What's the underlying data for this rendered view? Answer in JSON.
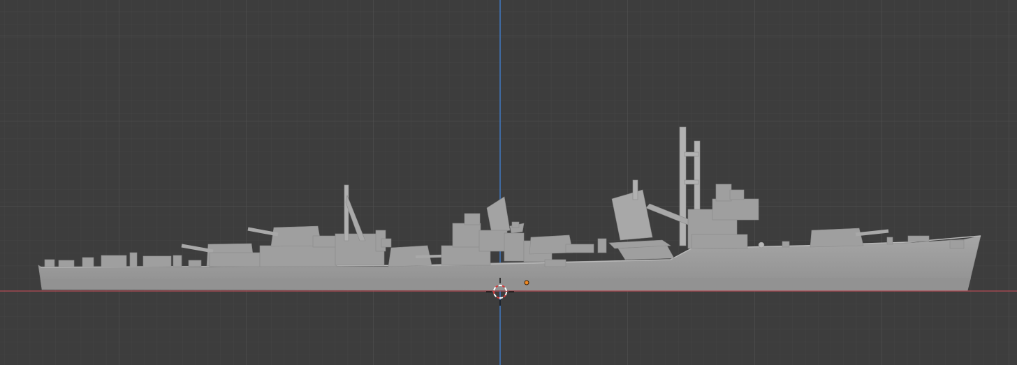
{
  "viewport": {
    "kind": "3d-viewport",
    "view": "side-orthographic",
    "background_color": "#3d3d3d",
    "grid_minor_color": "#454545",
    "grid_major_color": "#525252",
    "x_axis_color": "#b34a52",
    "z_axis_color": "#3e78c2",
    "model_color": "#9e9e9e",
    "origin_color": "#f08a24",
    "cursor_colors": [
      "#ffffff",
      "#d23c3c"
    ]
  },
  "scene": {
    "object": "ship-model",
    "icons": [
      "3d-cursor-icon",
      "object-origin-icon"
    ]
  }
}
